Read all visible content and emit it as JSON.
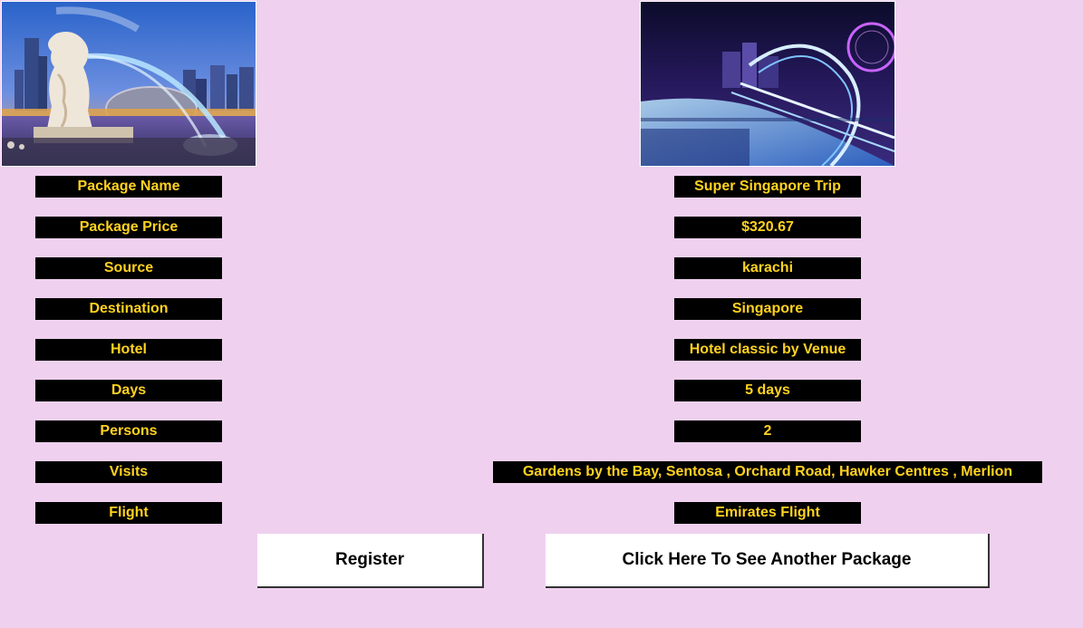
{
  "fields": [
    {
      "key": "package-name",
      "label": "Package Name",
      "value": "Super Singapore Trip"
    },
    {
      "key": "package-price",
      "label": "Package Price",
      "value": "$320.67"
    },
    {
      "key": "source",
      "label": "Source",
      "value": "karachi"
    },
    {
      "key": "destination",
      "label": "Destination",
      "value": "Singapore"
    },
    {
      "key": "hotel",
      "label": "Hotel",
      "value": "Hotel classic by Venue"
    },
    {
      "key": "days",
      "label": "Days",
      "value": "5 days"
    },
    {
      "key": "persons",
      "label": "Persons",
      "value": "2"
    },
    {
      "key": "visits",
      "label": "Visits",
      "value": "Gardens by the Bay, Sentosa  , Orchard Road, Hawker Centres , Merlion"
    },
    {
      "key": "flight",
      "label": "Flight",
      "value": "Emirates Flight"
    }
  ],
  "buttons": {
    "register": "Register",
    "another_package": "Click Here To See Another Package"
  },
  "colors": {
    "background": "#efd1ef",
    "box": "#000000",
    "box_text": "#ffd21f"
  }
}
